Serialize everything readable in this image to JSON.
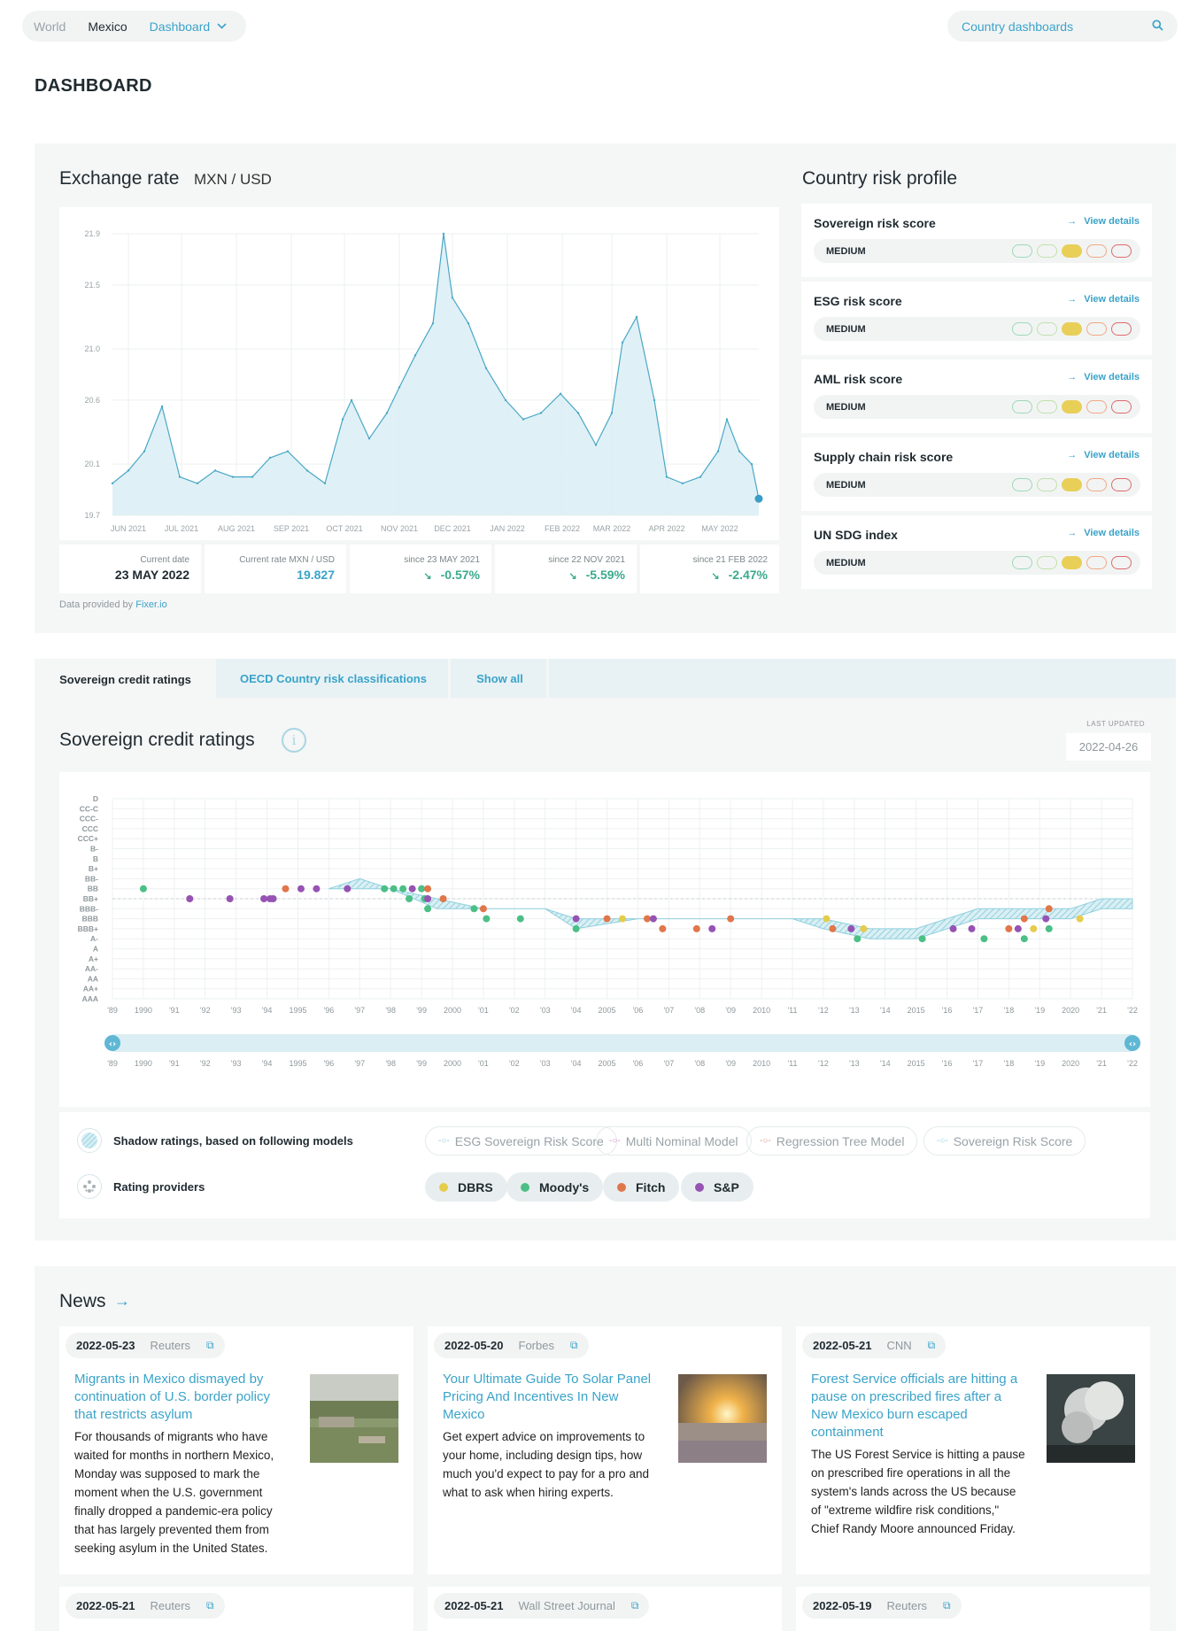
{
  "nav": {
    "world": "World",
    "country": "Mexico",
    "dashboard": "Dashboard",
    "search_placeholder": "Country dashboards"
  },
  "page_title": "DASHBOARD",
  "exchange": {
    "title": "Exchange rate",
    "pair": "MXN / USD",
    "stats": [
      {
        "label": "Current date",
        "value": "23 MAY 2022"
      },
      {
        "label": "Current rate MXN / USD",
        "value": "19.827"
      },
      {
        "label": "since 23 MAY 2021",
        "value": "-0.57%"
      },
      {
        "label": "since 22 NOV 2021",
        "value": "-5.59%"
      },
      {
        "label": "since 21 FEB 2022",
        "value": "-2.47%"
      }
    ],
    "provided_prefix": "Data provided by",
    "provided_source": "Fixer.io"
  },
  "risk": {
    "title": "Country risk profile",
    "view_label": "View details",
    "items": [
      {
        "name": "Sovereign risk score",
        "level": "MEDIUM"
      },
      {
        "name": "ESG risk score",
        "level": "MEDIUM"
      },
      {
        "name": "AML risk score",
        "level": "MEDIUM"
      },
      {
        "name": "Supply chain risk score",
        "level": "MEDIUM"
      },
      {
        "name": "UN SDG index",
        "level": "MEDIUM"
      }
    ],
    "pill_colors": [
      "#9dd9b6",
      "#bfe2a8",
      "#e8cf58",
      "#f0a984",
      "#e06a6a"
    ],
    "active_level_index": 2
  },
  "tabs": {
    "sovereign": "Sovereign credit ratings",
    "oecd": "OECD Country risk classifications",
    "show_all": "Show all"
  },
  "sovereign": {
    "title": "Sovereign credit ratings",
    "last_updated_label": "LAST UPDATED",
    "last_updated_value": "2022-04-26",
    "shadow_label": "Shadow ratings, based on following models",
    "providers_label": "Rating providers",
    "models": [
      "ESG Sovereign Risk Score",
      "Multi Nominal Model",
      "Regression Tree Model",
      "Sovereign Risk Score"
    ],
    "model_colors": [
      "#8fd0dd",
      "#d58fc4",
      "#e6978b",
      "#8fd0dd"
    ],
    "providers": [
      {
        "name": "DBRS",
        "color": "#e6cc4d"
      },
      {
        "name": "Moody's",
        "color": "#4bbf85"
      },
      {
        "name": "Fitch",
        "color": "#e0764a"
      },
      {
        "name": "S&P",
        "color": "#9653b3"
      }
    ]
  },
  "news": {
    "title": "News",
    "cards": [
      {
        "date": "2022-05-23",
        "source": "Reuters",
        "headline": "Migrants in Mexico dismayed by continuation of U.S. border policy that restricts asylum",
        "body": "For thousands of migrants who have waited for months in northern Mexico, Monday was supposed to mark the moment when the U.S. government finally dropped a pandemic-era policy that has largely prevented them from seeking asylum in the United States."
      },
      {
        "date": "2022-05-20",
        "source": "Forbes",
        "headline": "Your Ultimate Guide To Solar Panel Pricing And Incentives In New Mexico",
        "body": "Get expert advice on improvements to your home, including design tips, how much you'd expect to pay for a pro and what to ask when hiring experts."
      },
      {
        "date": "2022-05-21",
        "source": "CNN",
        "headline": "Forest Service officials are hitting a pause on prescribed fires after a New Mexico burn escaped containment",
        "body": "The US Forest Service is hitting a pause on prescribed fire operations in all the system's lands across the US because of \"extreme wildfire risk conditions,\" Chief Randy Moore announced Friday."
      },
      {
        "date": "2022-05-21",
        "source": "Reuters"
      },
      {
        "date": "2022-05-21",
        "source": "Wall Street Journal"
      },
      {
        "date": "2022-05-19",
        "source": "Reuters"
      }
    ]
  },
  "chart_data": [
    {
      "type": "area",
      "title": "",
      "xlabel": "",
      "ylabel": "",
      "ylim": [
        19.7,
        21.9
      ],
      "y_ticks": [
        "21.9",
        "21.5",
        "21.0",
        "20.6",
        "20.1",
        "19.7"
      ],
      "x_ticks": [
        "JUN 2021",
        "JUL 2021",
        "AUG 2021",
        "SEP 2021",
        "OCT 2021",
        "NOV 2021",
        "DEC 2021",
        "JAN 2022",
        "FEB 2022",
        "MAR 2022",
        "APR 2022",
        "MAY 2022"
      ],
      "x": [
        "2021-05-23",
        "2021-06-01",
        "2021-06-10",
        "2021-06-20",
        "2021-06-30",
        "2021-07-10",
        "2021-07-20",
        "2021-07-30",
        "2021-08-10",
        "2021-08-20",
        "2021-08-30",
        "2021-09-10",
        "2021-09-20",
        "2021-09-30",
        "2021-10-05",
        "2021-10-15",
        "2021-10-25",
        "2021-11-01",
        "2021-11-10",
        "2021-11-20",
        "2021-11-26",
        "2021-12-01",
        "2021-12-10",
        "2021-12-20",
        "2021-12-31",
        "2022-01-10",
        "2022-01-20",
        "2022-01-31",
        "2022-02-10",
        "2022-02-20",
        "2022-03-01",
        "2022-03-07",
        "2022-03-15",
        "2022-03-25",
        "2022-04-01",
        "2022-04-10",
        "2022-04-20",
        "2022-04-30",
        "2022-05-05",
        "2022-05-12",
        "2022-05-19",
        "2022-05-23"
      ],
      "values": [
        19.95,
        20.05,
        20.2,
        20.55,
        20.0,
        19.95,
        20.05,
        20.0,
        20.0,
        20.15,
        20.2,
        20.05,
        19.95,
        20.45,
        20.6,
        20.3,
        20.5,
        20.7,
        20.95,
        21.2,
        21.9,
        21.4,
        21.2,
        20.85,
        20.6,
        20.45,
        20.5,
        20.65,
        20.5,
        20.25,
        20.5,
        21.05,
        21.25,
        20.6,
        20.0,
        19.95,
        20.0,
        20.2,
        20.45,
        20.2,
        20.1,
        19.83
      ]
    },
    {
      "type": "scatter",
      "title": "",
      "xlabel": "",
      "ylabel": "",
      "x_ticks": [
        "'89",
        "1990",
        "'91",
        "'92",
        "'93",
        "'94",
        "1995",
        "'96",
        "'97",
        "'98",
        "'99",
        "2000",
        "'01",
        "'02",
        "'03",
        "'04",
        "2005",
        "'06",
        "'07",
        "'08",
        "'09",
        "2010",
        "'11",
        "'12",
        "'13",
        "'14",
        "2015",
        "'16",
        "'17",
        "'18",
        "'19",
        "2020",
        "'21",
        "'22"
      ],
      "y_ticks": [
        "D",
        "CC-C",
        "CCC-",
        "CCC",
        "CCC+",
        "B-",
        "B",
        "B+",
        "BB-",
        "BB",
        "BB+",
        "BBB-",
        "BBB",
        "BBB+",
        "A-",
        "A",
        "A+",
        "AA-",
        "AA",
        "AA+",
        "AAA"
      ],
      "shadow_band": [
        {
          "year": 1996.0,
          "lo": "BB",
          "hi": "BB"
        },
        {
          "year": 1997.0,
          "lo": "BB",
          "hi": "BB-"
        },
        {
          "year": 1998.0,
          "lo": "BB",
          "hi": "BB"
        },
        {
          "year": 1999.5,
          "lo": "BBB-",
          "hi": "BB+"
        },
        {
          "year": 2001.0,
          "lo": "BBB-",
          "hi": "BBB-"
        },
        {
          "year": 2003.0,
          "lo": "BBB-",
          "hi": "BBB-"
        },
        {
          "year": 2004.0,
          "lo": "BBB+",
          "hi": "BBB"
        },
        {
          "year": 2006.0,
          "lo": "BBB",
          "hi": "BBB"
        },
        {
          "year": 2011.0,
          "lo": "BBB",
          "hi": "BBB"
        },
        {
          "year": 2012.0,
          "lo": "BBB+",
          "hi": "BBB"
        },
        {
          "year": 2013.5,
          "lo": "A-",
          "hi": "BBB+"
        },
        {
          "year": 2015.0,
          "lo": "A-",
          "hi": "BBB+"
        },
        {
          "year": 2017.0,
          "lo": "BBB",
          "hi": "BBB-"
        },
        {
          "year": 2019.0,
          "lo": "BBB",
          "hi": "BBB-"
        },
        {
          "year": 2020.0,
          "lo": "BBB",
          "hi": "BBB-"
        },
        {
          "year": 2021.0,
          "lo": "BBB-",
          "hi": "BB+"
        },
        {
          "year": 2022.0,
          "lo": "BBB-",
          "hi": "BB+"
        }
      ],
      "series": [
        {
          "name": "DBRS",
          "points": [
            [
              "2005.5",
              "BBB"
            ],
            [
              "2012.1",
              "BBB"
            ],
            [
              "2013.3",
              "BBB+"
            ],
            [
              "2018.8",
              "BBB+"
            ],
            [
              "2020.3",
              "BBB"
            ]
          ]
        },
        {
          "name": "Moody's",
          "points": [
            [
              "1990.0",
              "BB"
            ],
            [
              "1997.8",
              "BB"
            ],
            [
              "1998.1",
              "BB"
            ],
            [
              "1998.4",
              "BB"
            ],
            [
              "1998.6",
              "BB+"
            ],
            [
              "1999.0",
              "BB"
            ],
            [
              "1999.1",
              "BB+"
            ],
            [
              "1999.2",
              "BBB-"
            ],
            [
              "2000.7",
              "BBB-"
            ],
            [
              "2001.1",
              "BBB"
            ],
            [
              "2002.2",
              "BBB"
            ],
            [
              "2004.0",
              "BBB+"
            ],
            [
              "2013.1",
              "A-"
            ],
            [
              "2015.2",
              "A-"
            ],
            [
              "2017.2",
              "A-"
            ],
            [
              "2018.5",
              "A-"
            ],
            [
              "2019.3",
              "BBB+"
            ]
          ]
        },
        {
          "name": "Fitch",
          "points": [
            [
              "1994.6",
              "BB"
            ],
            [
              "1999.2",
              "BB"
            ],
            [
              "1999.7",
              "BB+"
            ],
            [
              "2001.0",
              "BBB-"
            ],
            [
              "2005.0",
              "BBB"
            ],
            [
              "2006.3",
              "BBB"
            ],
            [
              "2006.8",
              "BBB+"
            ],
            [
              "2007.9",
              "BBB+"
            ],
            [
              "2009.0",
              "BBB"
            ],
            [
              "2012.3",
              "BBB+"
            ],
            [
              "2018.0",
              "BBB+"
            ],
            [
              "2018.5",
              "BBB"
            ],
            [
              "2019.3",
              "BBB-"
            ]
          ]
        },
        {
          "name": "S&P",
          "points": [
            [
              "1991.5",
              "BB+"
            ],
            [
              "1992.8",
              "BB+"
            ],
            [
              "1993.9",
              "BB+"
            ],
            [
              "1994.1",
              "BB+"
            ],
            [
              "1994.2",
              "BB+"
            ],
            [
              "1995.1",
              "BB"
            ],
            [
              "1995.6",
              "BB"
            ],
            [
              "1996.6",
              "BB"
            ],
            [
              "1998.7",
              "BB"
            ],
            [
              "1999.2",
              "BB+"
            ],
            [
              "2004.0",
              "BBB"
            ],
            [
              "2006.5",
              "BBB"
            ],
            [
              "2008.4",
              "BBB+"
            ],
            [
              "2012.9",
              "BBB+"
            ],
            [
              "2016.2",
              "BBB+"
            ],
            [
              "2016.8",
              "BBB+"
            ],
            [
              "2018.3",
              "BBB+"
            ],
            [
              "2019.2",
              "BBB"
            ]
          ]
        }
      ]
    }
  ]
}
